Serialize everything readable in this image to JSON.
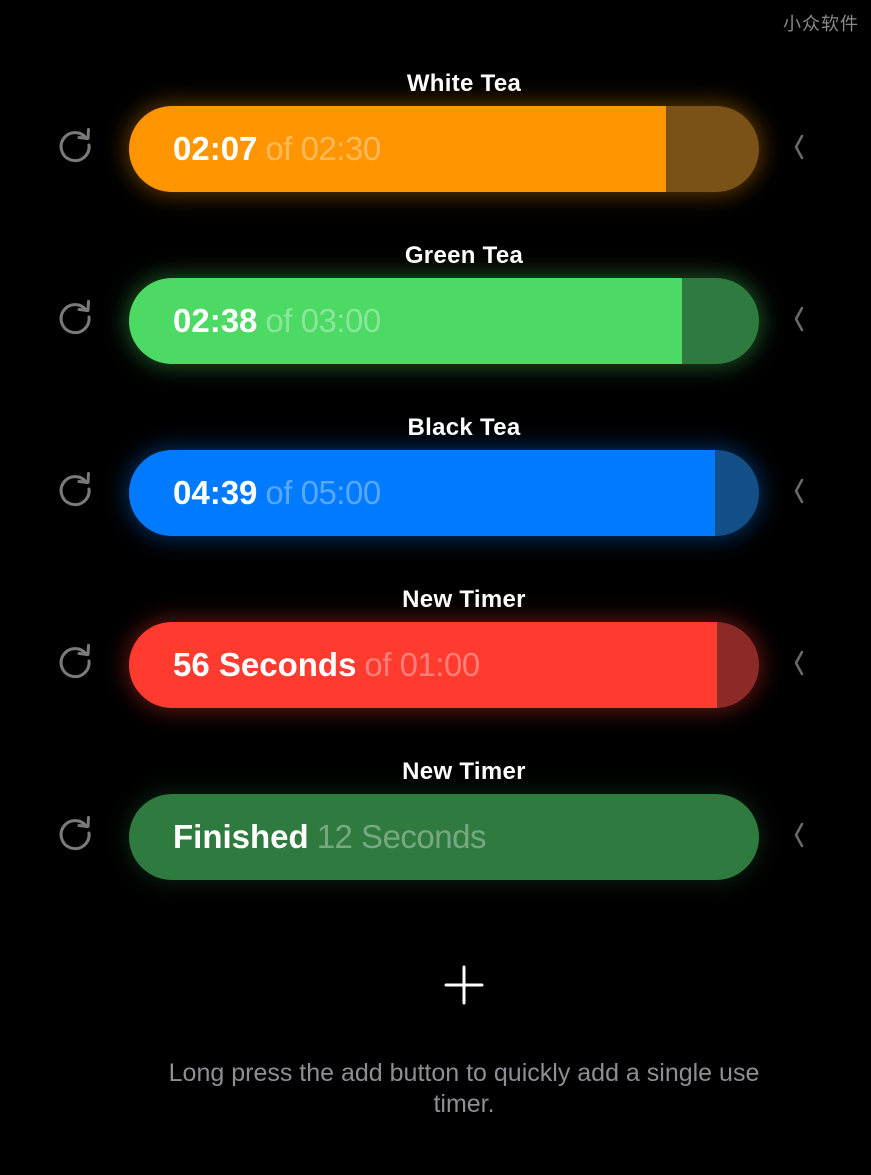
{
  "watermark": "小众软件",
  "timers": [
    {
      "name": "White Tea",
      "main": "02:07",
      "sub": "of 02:30",
      "progress": 0.853,
      "color": "#FF9500",
      "track_color": "#7A5116",
      "glow": "rgba(255,149,0,0.35)"
    },
    {
      "name": "Green Tea",
      "main": "02:38",
      "sub": "of 03:00",
      "progress": 0.878,
      "color": "#4CD964",
      "track_color": "#2F7A3F",
      "glow": "rgba(76,217,100,0.35)"
    },
    {
      "name": "Black Tea",
      "main": "04:39",
      "sub": "of 05:00",
      "progress": 0.93,
      "color": "#007AFF",
      "track_color": "#124F87",
      "glow": "rgba(0,122,255,0.35)"
    },
    {
      "name": "New Timer",
      "main": "56 Seconds",
      "sub": "of 01:00",
      "progress": 0.933,
      "color": "#FF3B30",
      "track_color": "#8C2A28",
      "glow": "rgba(255,59,48,0.35)"
    },
    {
      "name": "New Timer",
      "main": "Finished",
      "sub": "12 Seconds",
      "progress": 0,
      "color": "#2F7A3F",
      "track_color": "#2F7A3F",
      "glow": "rgba(47,122,63,0.25)"
    }
  ],
  "icons": {
    "reset": "refresh-icon",
    "chevron": "chevron-left-icon",
    "add": "plus-icon"
  },
  "hint_text": "Long press the add button to quickly add a single use timer."
}
